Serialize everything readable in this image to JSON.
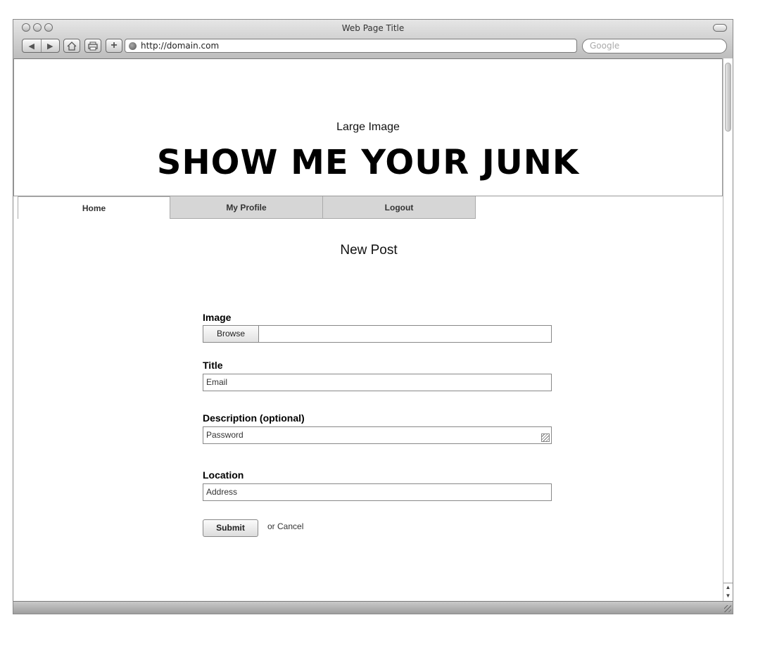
{
  "browser": {
    "window_title": "Web Page Title",
    "url": "http://domain.com",
    "search_placeholder": "Google"
  },
  "banner": {
    "image_label": "Large Image",
    "site_title": "SHOW ME YOUR JUNK"
  },
  "tabs": [
    {
      "label": "Home",
      "active": true
    },
    {
      "label": "My Profile",
      "active": false
    },
    {
      "label": "Logout",
      "active": false
    }
  ],
  "page": {
    "heading": "New Post"
  },
  "form": {
    "image_label": "Image",
    "browse_label": "Browse",
    "title_label": "Title",
    "title_value": "Email",
    "description_label": "Description (optional)",
    "description_value": "Password",
    "location_label": "Location",
    "location_value": "Address",
    "submit_label": "Submit",
    "cancel_label": "or Cancel"
  }
}
